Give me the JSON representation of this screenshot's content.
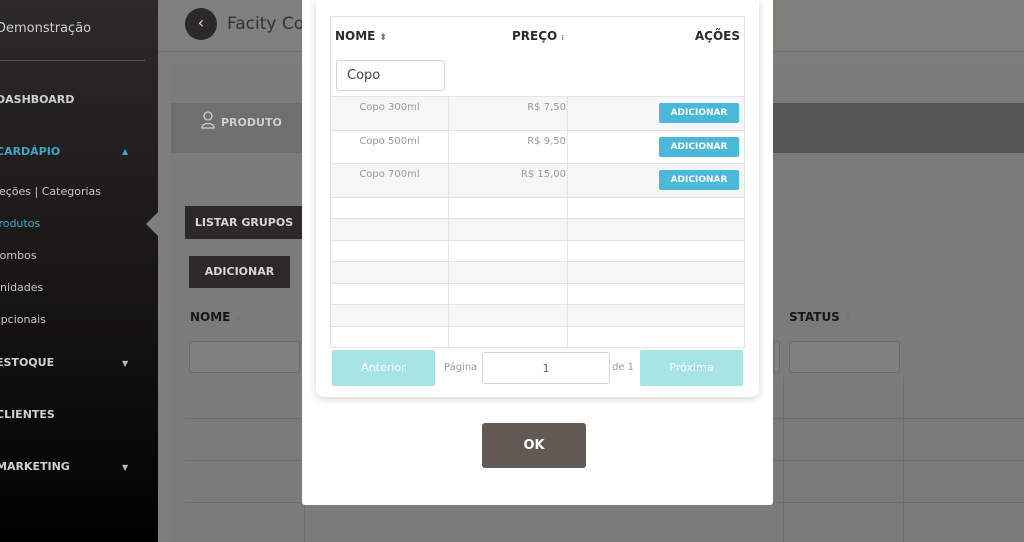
{
  "sidebar": {
    "title": "Demonstração",
    "items": [
      {
        "label": "DASHBOARD"
      },
      {
        "label": "CARDÁPIO"
      },
      {
        "label": "ESTOQUE"
      },
      {
        "label": "CLIENTES"
      },
      {
        "label": "MARKETING"
      }
    ],
    "subitems": [
      {
        "label": "Seções | Categorias"
      },
      {
        "label": "Produtos"
      },
      {
        "label": "Combos"
      },
      {
        "label": "Unidades"
      },
      {
        "label": "Opcionais"
      }
    ]
  },
  "header": {
    "title": "Facity Co"
  },
  "background": {
    "tab_label": "PRODUTO",
    "list_groups_button": "LISTAR GRUPOS",
    "add_button": "ADICIONAR",
    "col_nome": "NOME",
    "col_status": "STATUS"
  },
  "modal": {
    "table": {
      "headers": {
        "nome": "NOME",
        "preco": "PREÇO",
        "acoes": "AÇÕES"
      },
      "filter_value": "Copo",
      "rows": [
        {
          "nome": "Copo 300ml",
          "preco": "R$ 7,50",
          "action": "ADICIONAR"
        },
        {
          "nome": "Copo 500ml",
          "preco": "R$ 9,50",
          "action": "ADICIONAR"
        },
        {
          "nome": "Copo 700ml",
          "preco": "R$ 15,00",
          "action": "ADICIONAR"
        }
      ]
    },
    "pagination": {
      "prev": "Anterior",
      "page_label": "Página",
      "page": "1",
      "of_label": "de 1",
      "next": "Próxima"
    },
    "ok": "OK"
  },
  "colors": {
    "accent": "#4ab8d8",
    "pager_button": "#a6e4e6",
    "ok_button": "#615a54",
    "sidebar_active": "#3fa6c4"
  }
}
